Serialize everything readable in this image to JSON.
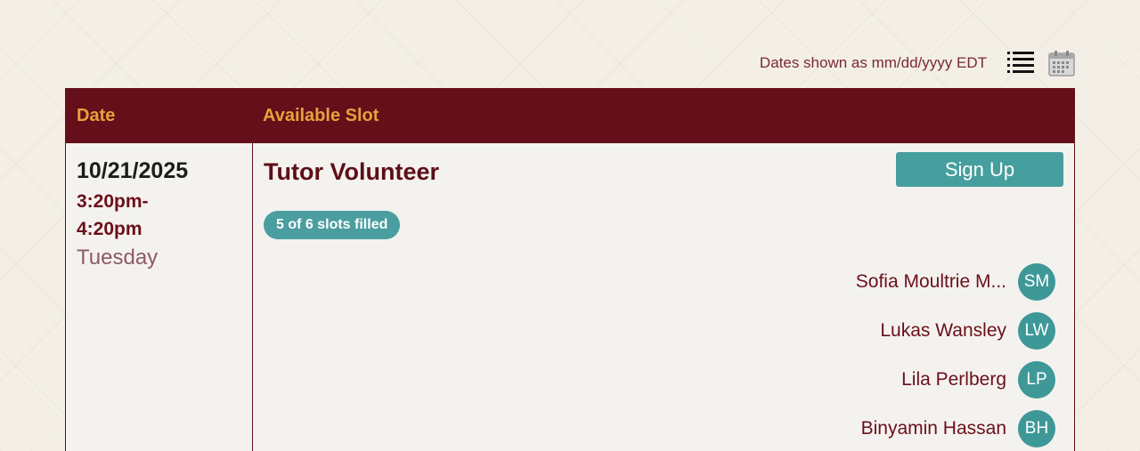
{
  "toolbar": {
    "timezone_note": "Dates shown as mm/dd/yyyy EDT",
    "list_view_icon": "list-view-icon",
    "calendar_view_icon": "calendar-view-icon"
  },
  "table": {
    "headers": {
      "date": "Date",
      "slot": "Available Slot"
    }
  },
  "slot": {
    "date": "10/21/2025",
    "time": "3:20pm-4:20pm",
    "day": "Tuesday",
    "title": "Tutor Volunteer",
    "signup_label": "Sign Up",
    "filled_badge": "5 of 6 slots filled",
    "volunteers": [
      {
        "name": "Sofia Moultrie M...",
        "initials": "SM"
      },
      {
        "name": "Lukas Wansley",
        "initials": "LW"
      },
      {
        "name": "Lila Perlberg",
        "initials": "LP"
      },
      {
        "name": "Binyamin Hassan",
        "initials": "BH"
      }
    ]
  },
  "colors": {
    "header_bg": "#640f1a",
    "header_text": "#e8a13a",
    "accent_teal": "#479e9e",
    "maroon_text": "#6b0f1a"
  }
}
